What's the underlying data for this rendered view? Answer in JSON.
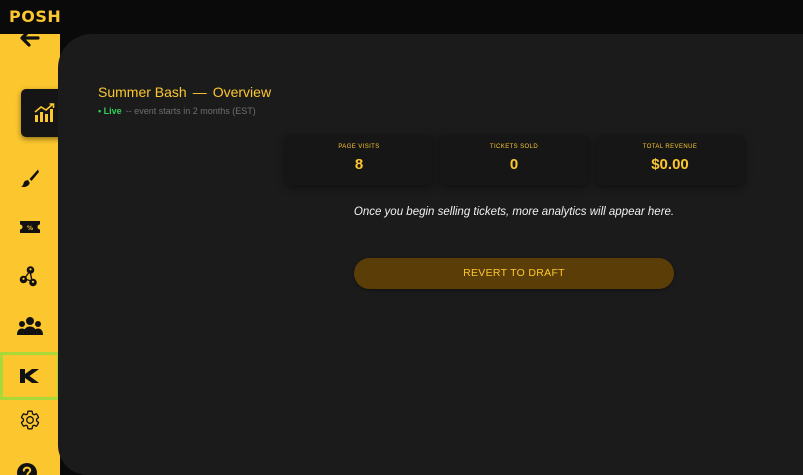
{
  "app": {
    "logo_text": "POSH"
  },
  "colors": {
    "brand_yellow": "#fcc72e",
    "live_green": "#2ed158",
    "highlight_green": "#a9d938",
    "background": "#1b1b1c",
    "card": "#161616",
    "button_bg": "#5b3e07"
  },
  "sidebar": {
    "back": {
      "icon": "arrow-left-icon"
    },
    "items": [
      {
        "name": "overview",
        "icon": "analytics-chart-icon",
        "active": true
      },
      {
        "name": "design",
        "icon": "paintbrush-icon"
      },
      {
        "name": "tickets",
        "icon": "ticket-icon"
      },
      {
        "name": "team",
        "icon": "user-network-icon"
      },
      {
        "name": "attendees",
        "icon": "people-group-icon"
      },
      {
        "name": "kickback",
        "icon": "kickback-k-icon",
        "highlighted": true
      },
      {
        "name": "settings",
        "icon": "gear-icon"
      },
      {
        "name": "help",
        "icon": "help-icon"
      }
    ]
  },
  "header": {
    "event_name": "Summer Bash",
    "separator": "—",
    "section": "Overview",
    "status_dot": "•",
    "status_live": "Live",
    "status_detail": "-- event starts in 2 months (EST)"
  },
  "stats": [
    {
      "label": "PAGE VISITS",
      "value": "8"
    },
    {
      "label": "TICKETS SOLD",
      "value": "0"
    },
    {
      "label": "TOTAL REVENUE",
      "value": "$0.00"
    }
  ],
  "analytics_message": "Once you begin selling tickets, more analytics will appear here.",
  "revert_button": {
    "label": "REVERT TO DRAFT"
  }
}
